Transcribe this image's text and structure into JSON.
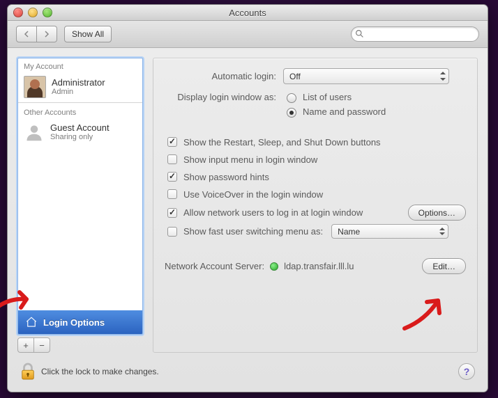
{
  "window": {
    "title": "Accounts"
  },
  "toolbar": {
    "show_all": "Show All",
    "search_placeholder": ""
  },
  "sidebar": {
    "section_my": "My Account",
    "section_other": "Other Accounts",
    "accounts": [
      {
        "name": "Administrator",
        "role": "Admin"
      },
      {
        "name": "Guest Account",
        "role": "Sharing only"
      }
    ],
    "login_options": "Login Options"
  },
  "main": {
    "automatic_login_label": "Automatic login:",
    "automatic_login_value": "Off",
    "display_login_label": "Display login window as:",
    "radio_list": "List of users",
    "radio_namepw": "Name and password",
    "cb_restart": "Show the Restart, Sleep, and Shut Down buttons",
    "cb_input_menu": "Show input menu in login window",
    "cb_pw_hints": "Show password hints",
    "cb_voiceover": "Use VoiceOver in the login window",
    "cb_network_users": "Allow network users to log in at login window",
    "options_btn": "Options…",
    "cb_fast_switch": "Show fast user switching menu as:",
    "fast_switch_value": "Name",
    "net_acct_label": "Network Account Server:",
    "net_acct_value": "ldap.transfair.lll.lu",
    "edit_btn": "Edit…"
  },
  "footer": {
    "lock_text": "Click the lock to make changes."
  },
  "checked": {
    "restart": true,
    "input_menu": false,
    "pw_hints": true,
    "voiceover": false,
    "network_users": true,
    "fast_switch": false,
    "radio_selected": "namepw"
  }
}
